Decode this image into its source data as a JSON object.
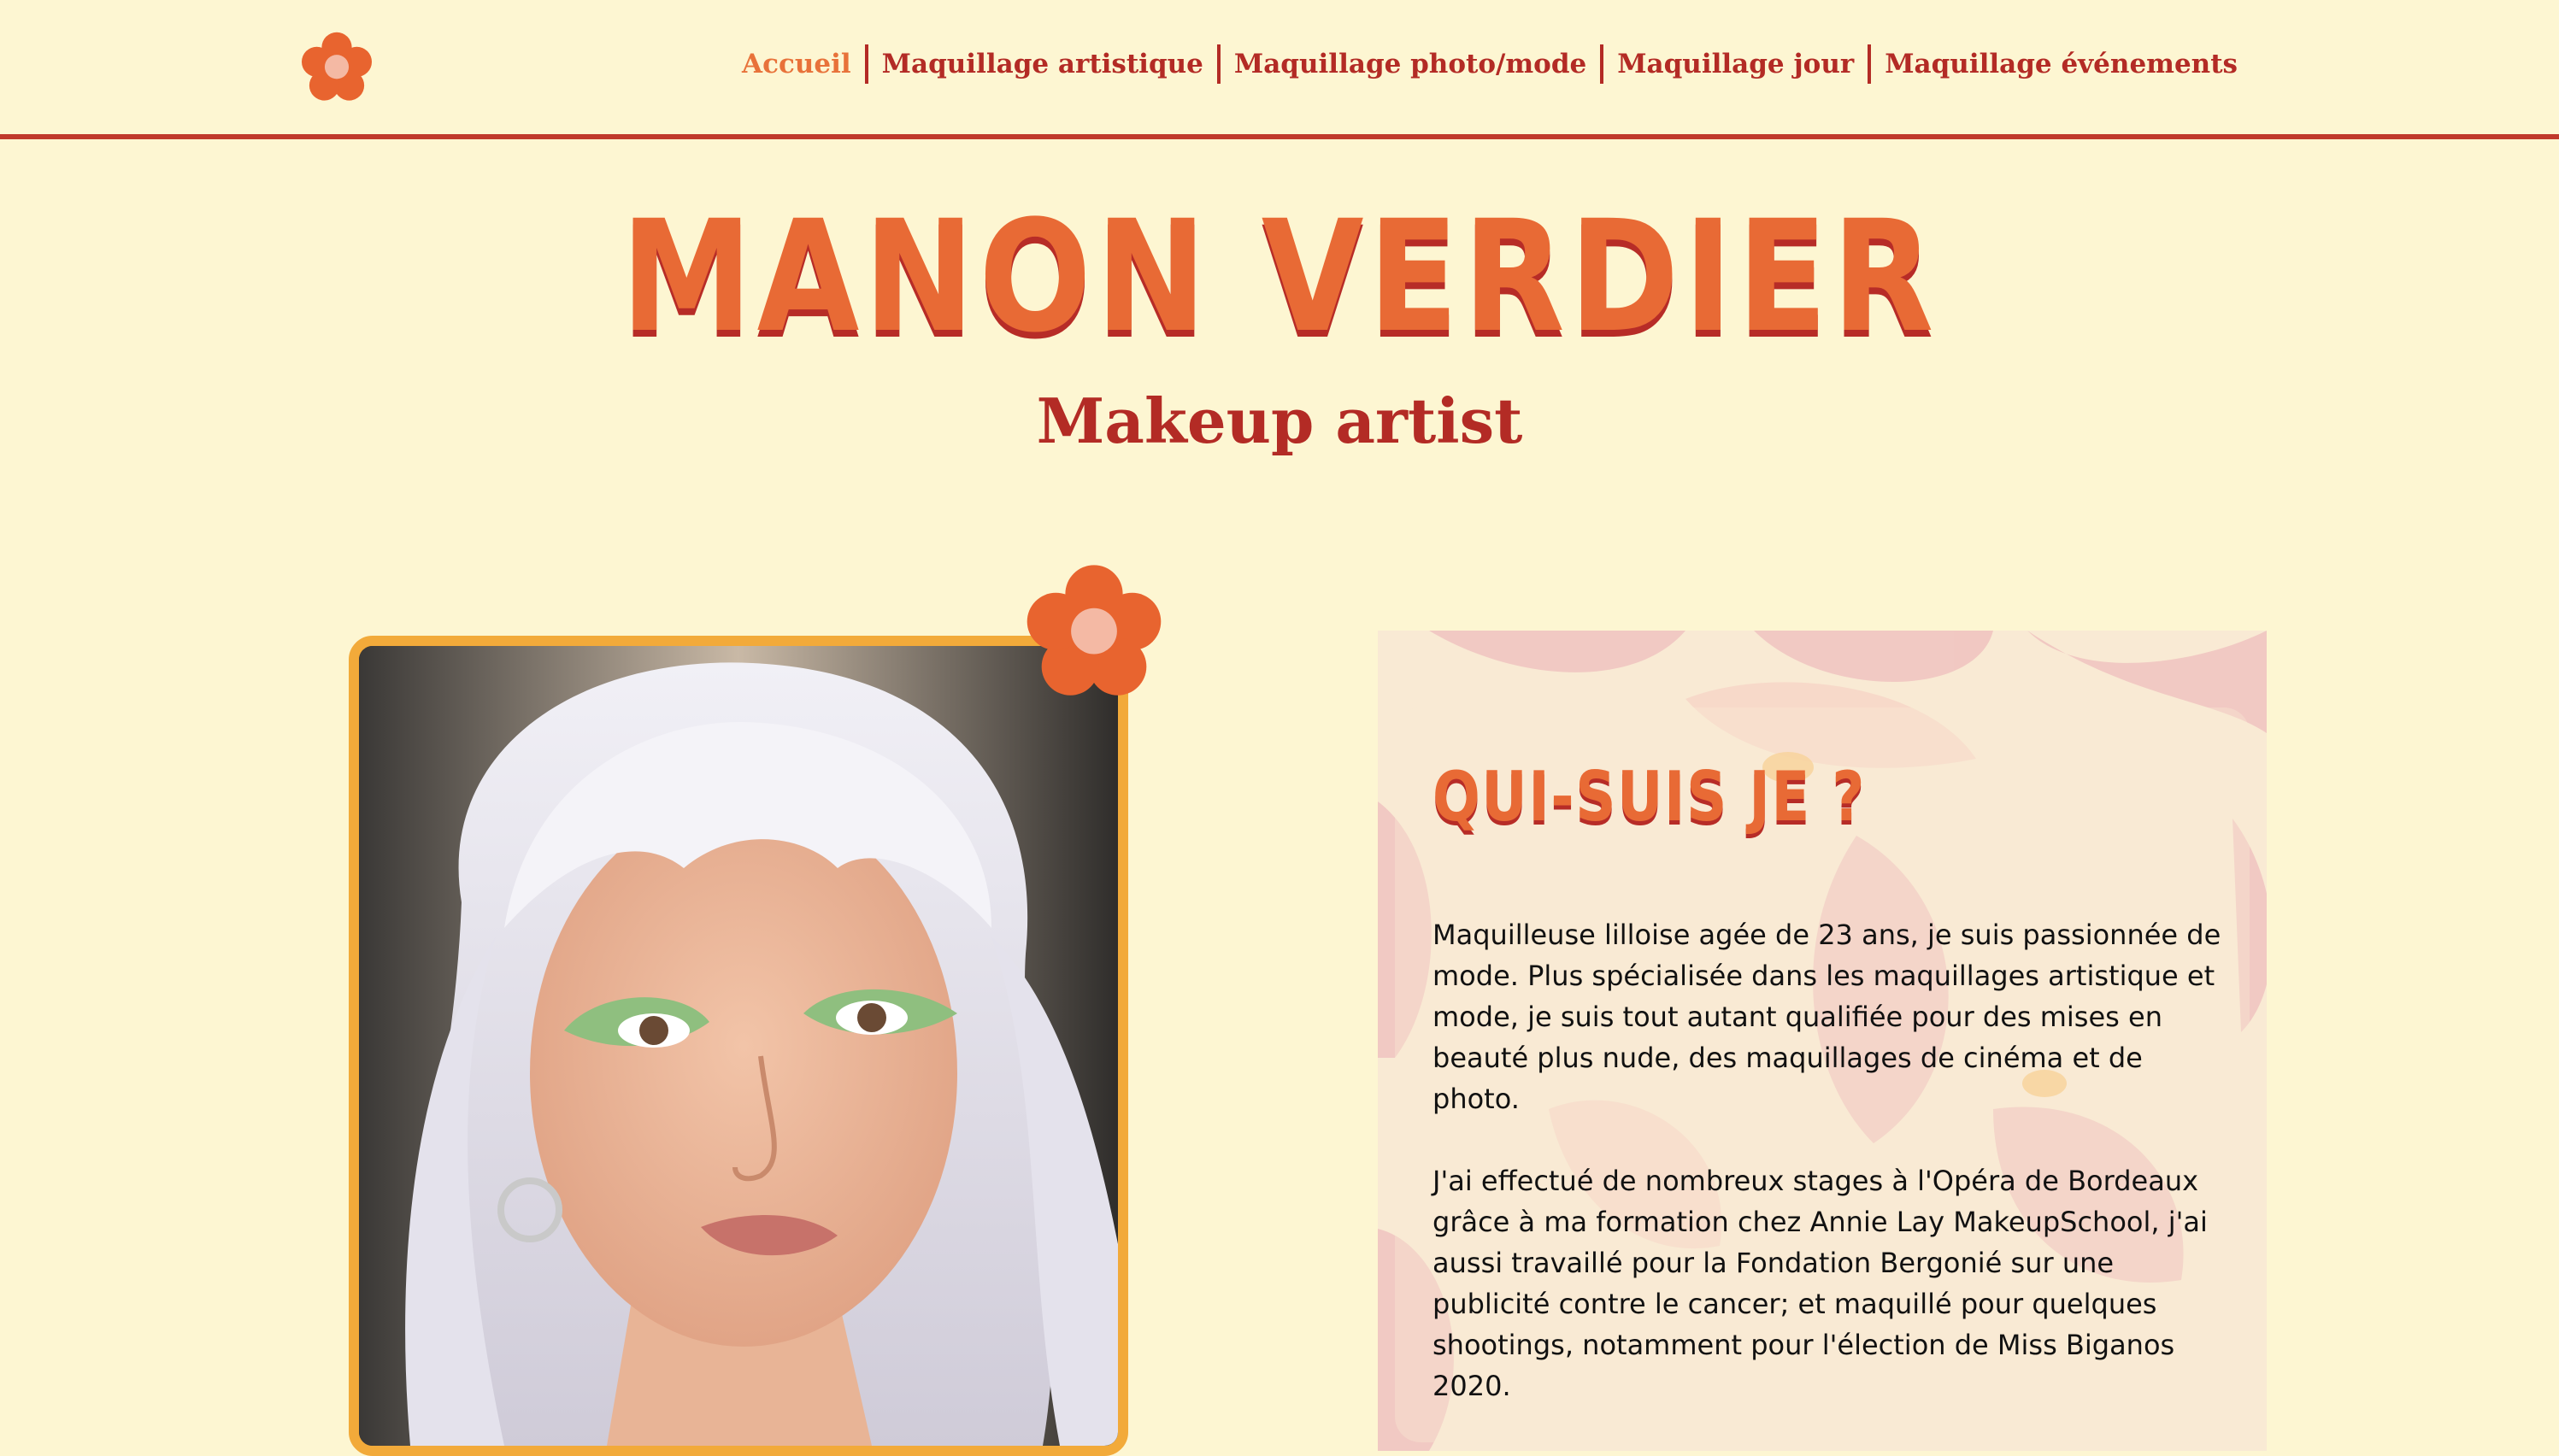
{
  "nav": {
    "items": [
      {
        "label": "Accueil",
        "active": true
      },
      {
        "label": "Maquillage artistique",
        "active": false
      },
      {
        "label": "Maquillage photo/mode",
        "active": false
      },
      {
        "label": "Maquillage jour",
        "active": false
      },
      {
        "label": "Maquillage événements",
        "active": false
      }
    ]
  },
  "hero": {
    "title": "MANON VERDIER",
    "subtitle": "Makeup artist"
  },
  "about": {
    "heading": "QUI-SUIS JE ?",
    "paragraph1": "Maquilleuse lilloise agée de 23 ans, je suis passionnée de mode. Plus spécialisée dans les maquillages artistique et mode, je suis tout autant qualifiée pour des mises en beauté plus nude, des maquillages de cinéma et de photo.",
    "paragraph2": "J'ai effectué de nombreux stages à l'Opéra de Bordeaux grâce à ma formation chez Annie Lay MakeupSchool, j'ai aussi travaillé pour la Fondation Bergonié sur une publicité contre le cancer; et maquillé pour quelques shootings, notamment pour l'élection de Miss Biganos 2020."
  },
  "icons": {
    "logo": "flower-icon",
    "photo_decoration": "flower-icon"
  },
  "colors": {
    "background": "#fdf6d2",
    "primary_red": "#b32b25",
    "accent_orange": "#e86a35",
    "frame_gold": "#f2aa3a",
    "flower_center": "#f4b9a4"
  }
}
